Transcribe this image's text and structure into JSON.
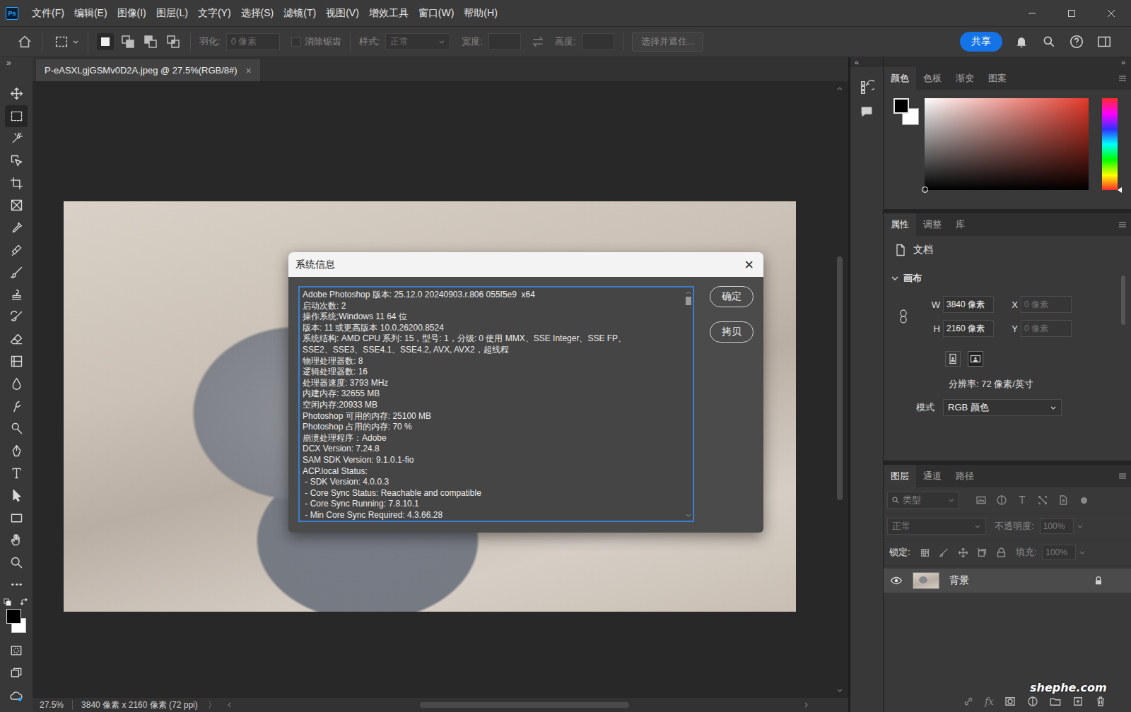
{
  "app": {
    "logo": "Ps"
  },
  "menu": [
    "文件(F)",
    "编辑(E)",
    "图像(I)",
    "图层(L)",
    "文字(Y)",
    "选择(S)",
    "滤镜(T)",
    "视图(V)",
    "增效工具",
    "窗口(W)",
    "帮助(H)"
  ],
  "options_bar": {
    "modes": [
      {
        "selected": true
      },
      {
        "selected": false
      },
      {
        "selected": false
      },
      {
        "selected": false
      }
    ],
    "feather": {
      "label": "羽化:",
      "value": "0 像素",
      "disabled": true
    },
    "antialias": {
      "label": "消除锯齿",
      "checked": false,
      "disabled": true
    },
    "style": {
      "label": "样式:",
      "value": "正常",
      "disabled": true
    },
    "width": {
      "label": "宽度:",
      "value": "",
      "disabled": true
    },
    "height": {
      "label": "高度:",
      "value": "",
      "disabled": true
    },
    "select_and_mask": {
      "label": "选择并遮住...",
      "disabled": true
    },
    "share": "共享"
  },
  "toolbar": {
    "collapse": "»",
    "tools": [
      {
        "selected": false
      },
      {
        "selected": true
      },
      {
        "selected": false
      },
      {
        "selected": false
      },
      {
        "selected": false
      },
      {
        "selected": false
      },
      {
        "selected": false
      },
      {
        "selected": false
      },
      {
        "selected": false
      },
      {
        "selected": false
      },
      {
        "selected": false
      },
      {
        "selected": false
      },
      {
        "selected": false
      },
      {
        "selected": false
      },
      {
        "selected": false
      },
      {
        "selected": false
      },
      {
        "selected": false
      },
      {
        "selected": false
      },
      {
        "selected": false
      },
      {
        "selected": false
      },
      {
        "selected": false
      },
      {
        "selected": false
      },
      {
        "selected": false
      }
    ]
  },
  "document_tab": {
    "title": "P-eASXLgjGSMv0D2A.jpeg @ 27.5%(RGB/8#)",
    "close": "×",
    "selected": true
  },
  "status_bar": {
    "zoom": "27.5%",
    "size": "3840 像素 x 2160 像素 (72 ppi)",
    "more": "〉"
  },
  "dialog": {
    "title": "系统信息",
    "close": "×",
    "lines": [
      "Adobe Photoshop 版本: 25.12.0 20240903.r.806 055f5e9  x64",
      "启动次数: 2",
      "操作系统:Windows 11 64 位",
      "版本: 11 或更高版本 10.0.26200.8524",
      "系统结构: AMD CPU 系列: 15，型号: 1，分级: 0 使用 MMX、SSE Integer、SSE FP、",
      "SSE2、SSE3、SSE4.1、SSE4.2, AVX, AVX2，超线程",
      "物理处理器数: 8",
      "逻辑处理器数: 16",
      "处理器速度: 3793 MHz",
      "内建内存: 32655 MB",
      "空闲内存:20933 MB",
      "Photoshop 可用的内存: 25100 MB",
      "Photoshop 占用的内存: 70 %",
      "崩溃处理程序：Adobe",
      "DCX Version: 7.24.8",
      "SAM SDK Version: 9.1.0.1-fio",
      "ACP.local Status:",
      " - SDK Version: 4.0.0.3",
      " - Core Sync Status: Reachable and compatible",
      " - Core Sync Running: 7.8.10.1",
      " - Min Core Sync Required: 4.3.66.28"
    ],
    "buttons": [
      "确定",
      "拷贝"
    ]
  },
  "side_strip": {
    "collapse": "«"
  },
  "panels": {
    "collapse": "»",
    "color": {
      "tabs": [
        {
          "label": "颜色",
          "selected": true
        },
        {
          "label": "色板",
          "selected": false
        },
        {
          "label": "渐变",
          "selected": false
        },
        {
          "label": "图案",
          "selected": false
        }
      ]
    },
    "properties": {
      "tabs": [
        {
          "label": "属性",
          "selected": true
        },
        {
          "label": "调整",
          "selected": false
        },
        {
          "label": "库",
          "selected": false
        }
      ],
      "kind_label": "文档",
      "section": {
        "label": "画布",
        "expanded": true
      },
      "fields": [
        {
          "label": "W",
          "value": "3840 像素",
          "disabled": false
        },
        {
          "label": "X",
          "value": "0 像素",
          "disabled": true
        },
        {
          "label": "H",
          "value": "2160 像素",
          "disabled": false
        },
        {
          "label": "Y",
          "value": "0 像素",
          "disabled": true
        }
      ],
      "orientation": [
        {
          "selected": false
        },
        {
          "selected": true
        }
      ],
      "resolution": "分辨率: 72 像素/英寸",
      "mode": {
        "label": "模式",
        "value": "RGB 颜色"
      }
    },
    "layers": {
      "tabs": [
        {
          "label": "图层",
          "selected": true
        },
        {
          "label": "通道",
          "selected": false
        },
        {
          "label": "路径",
          "selected": false
        }
      ],
      "filter": {
        "value": "类型"
      },
      "blend": {
        "value": "正常",
        "disabled": true
      },
      "opacity": {
        "label": "不透明度:",
        "value": "100%",
        "disabled": true
      },
      "lock": {
        "label": "锁定:"
      },
      "fill": {
        "label": "填充:",
        "value": "100%",
        "disabled": true
      },
      "items": [
        {
          "name": "背景",
          "visible": true,
          "locked": true,
          "selected": true
        }
      ],
      "footer_fx": "fx"
    }
  },
  "watermark": "shephe.com"
}
